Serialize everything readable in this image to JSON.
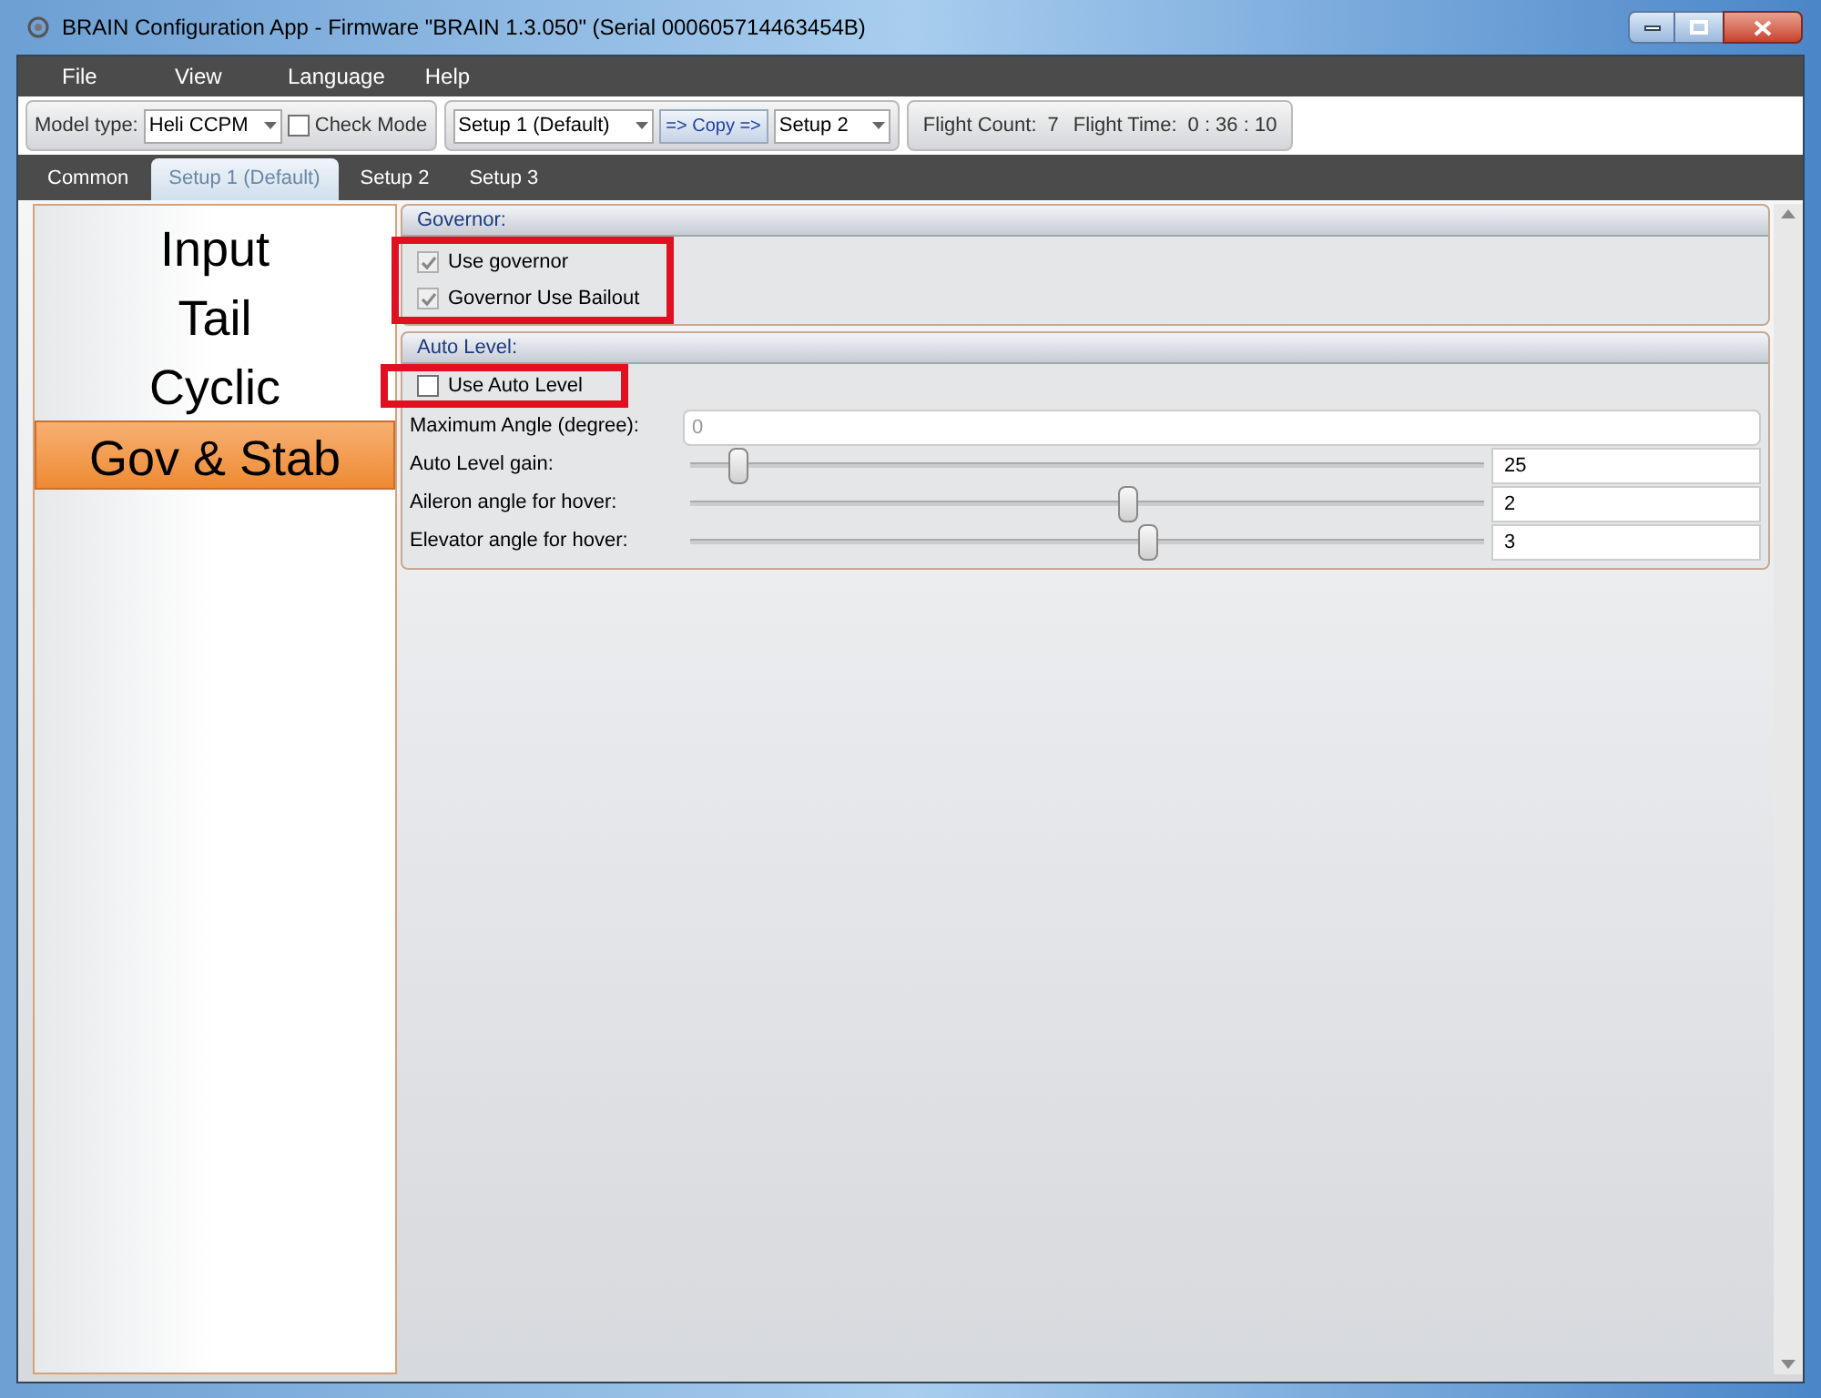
{
  "window": {
    "title": "BRAIN Configuration App - Firmware \"BRAIN 1.3.050\" (Serial 000605714463454B)"
  },
  "menu": [
    "File",
    "View",
    "Language",
    "Help"
  ],
  "toolbar": {
    "model_type_label": "Model type:",
    "model_type": "Heli CCPM",
    "check_mode": {
      "label": "Check Mode",
      "checked": false
    },
    "copy_from": "Setup 1 (Default)",
    "copy_button": "=> Copy =>",
    "copy_to": "Setup 2",
    "flight_count_label": "Flight Count:",
    "flight_count": "7",
    "flight_time_label": "Flight Time:",
    "flight_time": "0 : 36 : 10"
  },
  "tabs": [
    {
      "label": "Common",
      "selected": false
    },
    {
      "label": "Setup 1 (Default)",
      "selected": true
    },
    {
      "label": "Setup 2",
      "selected": false
    },
    {
      "label": "Setup 3",
      "selected": false
    }
  ],
  "nav": [
    {
      "label": "Input",
      "selected": false
    },
    {
      "label": "Tail",
      "selected": false
    },
    {
      "label": "Cyclic",
      "selected": false
    },
    {
      "label": "Gov & Stab",
      "selected": true
    }
  ],
  "governor": {
    "title": "Governor:",
    "highlighted": true,
    "checkboxes": [
      {
        "label": "Use governor",
        "checked": true,
        "disabled": true
      },
      {
        "label": "Governor Use Bailout",
        "checked": true,
        "disabled": true
      }
    ]
  },
  "auto_level": {
    "title": "Auto Level:",
    "checkbox": {
      "label": "Use Auto Level",
      "checked": false,
      "highlighted": true
    },
    "rows": [
      {
        "kind": "field",
        "label": "Maximum Angle (degree):",
        "value": "0"
      },
      {
        "kind": "slider",
        "label": "Auto Level gain:",
        "level": 0.06,
        "value": "25"
      },
      {
        "kind": "slider",
        "label": "Aileron angle for hover:",
        "level": 0.55,
        "value": "2"
      },
      {
        "kind": "slider",
        "label": "Elevator angle for hover:",
        "level": 0.575,
        "value": "3"
      }
    ]
  }
}
